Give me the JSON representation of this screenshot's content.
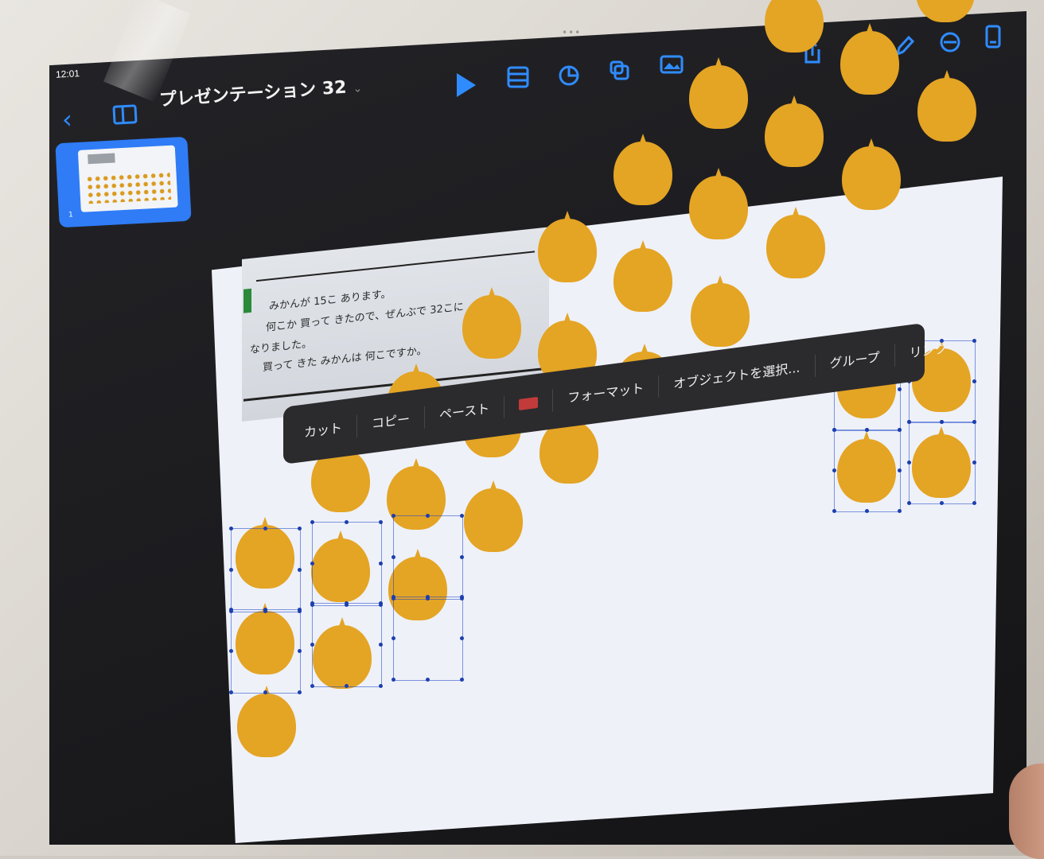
{
  "status": {
    "time": "12:01"
  },
  "top_dots": "•••",
  "navbar": {
    "back_glyph": "‹",
    "title": "プレゼンテーション 32",
    "title_chevron": "⌄"
  },
  "toolbar": {
    "icons": [
      "play-icon",
      "table-icon",
      "chart-icon",
      "shape-icon",
      "media-icon",
      "share-icon",
      "undo-icon",
      "pen-icon",
      "format-icon",
      "document-icon"
    ]
  },
  "navigator": {
    "slide_number": "1"
  },
  "problem_text": {
    "line1": "みかんが 15こ あります。",
    "line2": "何こか 買って きたので、ぜんぶで 32こに",
    "line3": "なりました。",
    "line4": "買って きた みかんは 何こですか。"
  },
  "context_menu": {
    "cut": "カット",
    "copy": "コピー",
    "paste": "ペースト",
    "format": "フォーマット",
    "select_object": "オブジェクトを選択...",
    "group": "グループ",
    "link": "リンク"
  },
  "colors": {
    "accent": "#2f8cff",
    "orange": "#e4a424",
    "menu_bg": "#2b2b2e",
    "slide_bg": "#eef1f8"
  }
}
